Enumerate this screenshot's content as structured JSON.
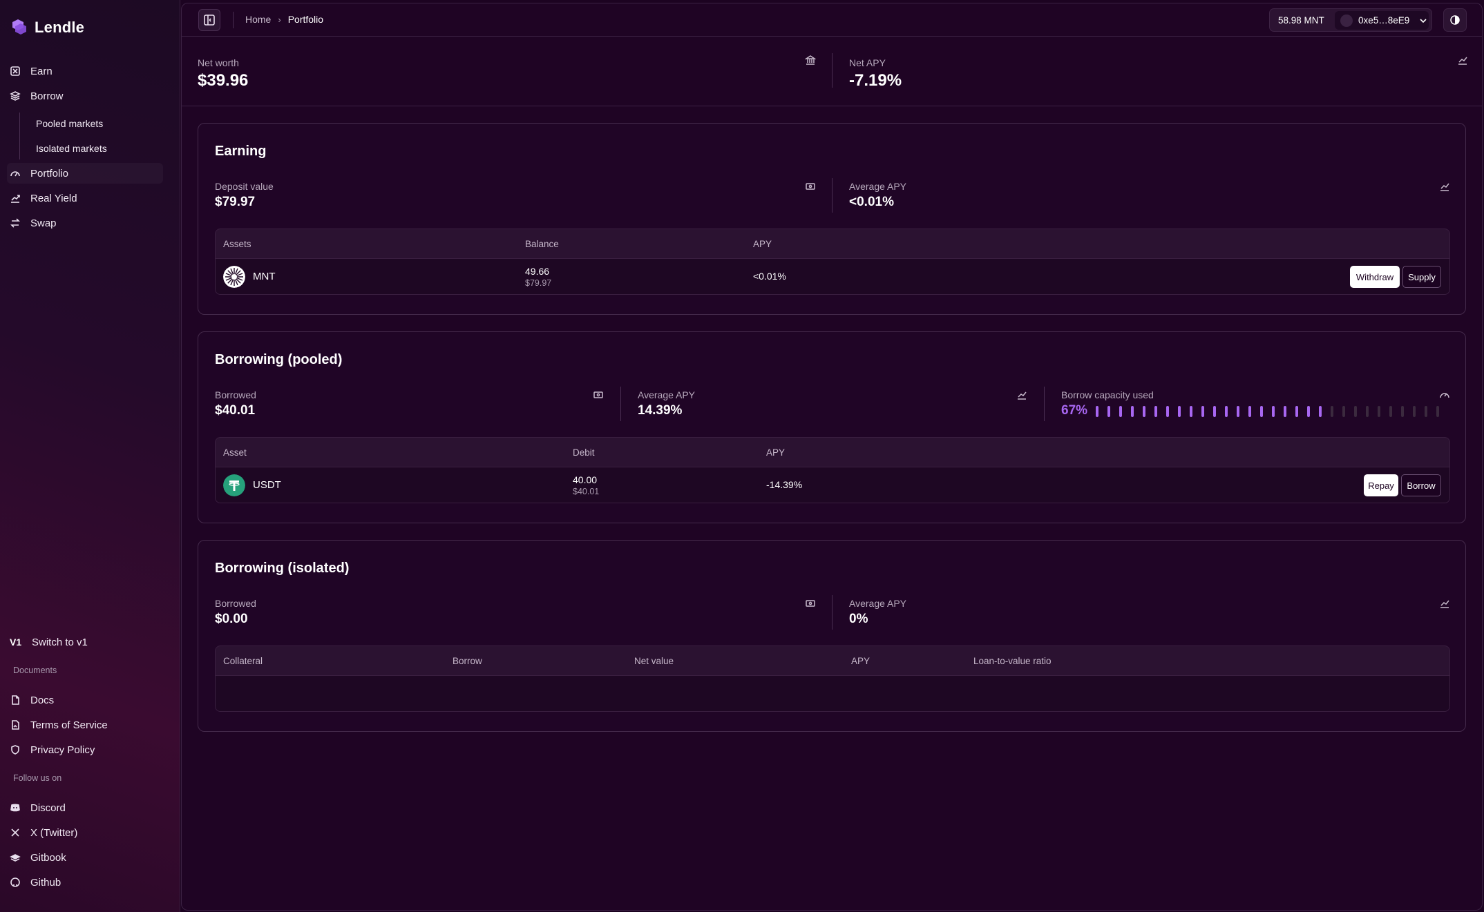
{
  "app": {
    "name": "Lendle",
    "brand_color": "#a867f2"
  },
  "sidebar": {
    "nav": [
      {
        "label": "Earn",
        "icon": "earn-icon"
      },
      {
        "label": "Borrow",
        "icon": "borrow-icon"
      },
      {
        "label": "Portfolio",
        "icon": "portfolio-icon",
        "active": true
      },
      {
        "label": "Real Yield",
        "icon": "real-yield-icon"
      },
      {
        "label": "Swap",
        "icon": "swap-icon"
      }
    ],
    "borrow_sub": [
      "Pooled markets",
      "Isolated markets"
    ],
    "switch_v1": {
      "mark": "V1",
      "label": "Switch to v1"
    },
    "documents_heading": "Documents",
    "documents": [
      "Docs",
      "Terms of Service",
      "Privacy Policy"
    ],
    "follow_heading": "Follow us on",
    "social": [
      "Discord",
      "X (Twitter)",
      "Gitbook",
      "Github"
    ]
  },
  "topbar": {
    "breadcrumb_home": "Home",
    "breadcrumb_current": "Portfolio",
    "balance": "58.98 MNT",
    "address": "0xe5…8eE9"
  },
  "summary": {
    "net_worth_label": "Net worth",
    "net_worth": "$39.96",
    "net_apy_label": "Net APY",
    "net_apy": "-7.19%"
  },
  "earning": {
    "title": "Earning",
    "deposit_label": "Deposit value",
    "deposit_value": "$79.97",
    "avg_apy_label": "Average APY",
    "avg_apy": "<0.01%",
    "columns": [
      "Assets",
      "Balance",
      "APY"
    ],
    "rows": [
      {
        "asset": "MNT",
        "balance": "49.66",
        "balance_usd": "$79.97",
        "apy": "<0.01%",
        "actions": [
          "Withdraw",
          "Supply"
        ]
      }
    ]
  },
  "borrowing_pooled": {
    "title": "Borrowing (pooled)",
    "borrowed_label": "Borrowed",
    "borrowed": "$40.01",
    "avg_apy_label": "Average APY",
    "avg_apy": "14.39%",
    "capacity_label": "Borrow capacity used",
    "capacity": "67%",
    "capacity_fraction": 0.67,
    "columns": [
      "Asset",
      "Debit",
      "APY"
    ],
    "rows": [
      {
        "asset": "USDT",
        "debit": "40.00",
        "debit_usd": "$40.01",
        "apy": "-14.39%",
        "actions": [
          "Repay",
          "Borrow"
        ]
      }
    ]
  },
  "borrowing_isolated": {
    "title": "Borrowing (isolated)",
    "borrowed_label": "Borrowed",
    "borrowed": "$0.00",
    "avg_apy_label": "Average APY",
    "avg_apy": "0%",
    "columns": [
      "Collateral",
      "Borrow",
      "Net value",
      "APY",
      "Loan-to-value ratio"
    ]
  }
}
